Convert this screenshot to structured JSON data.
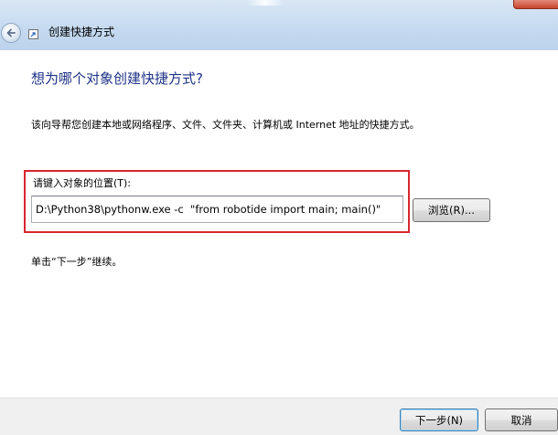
{
  "window": {
    "title": "创建快捷方式"
  },
  "icons": {
    "back": "back-arrow-icon",
    "wizard": "shortcut-wizard-icon"
  },
  "main": {
    "heading": "想为哪个对象创建快捷方式?",
    "description": "该向导帮您创建本地或网络程序、文件、文件夹、计算机或 Internet 地址的快捷方式。",
    "location_label": "请键入对象的位置(T):",
    "location_value": "D:\\Python38\\pythonw.exe -c  \"from robotide import main; main()\"",
    "browse_label": "浏览(R)...",
    "instruction": "单击“下一步”继续。"
  },
  "footer": {
    "next_label": "下一步(N)",
    "cancel_label": "取消"
  },
  "colors": {
    "heading": "#1e3287",
    "highlight": "#d8262e",
    "titlebar": "#c6daf0"
  }
}
